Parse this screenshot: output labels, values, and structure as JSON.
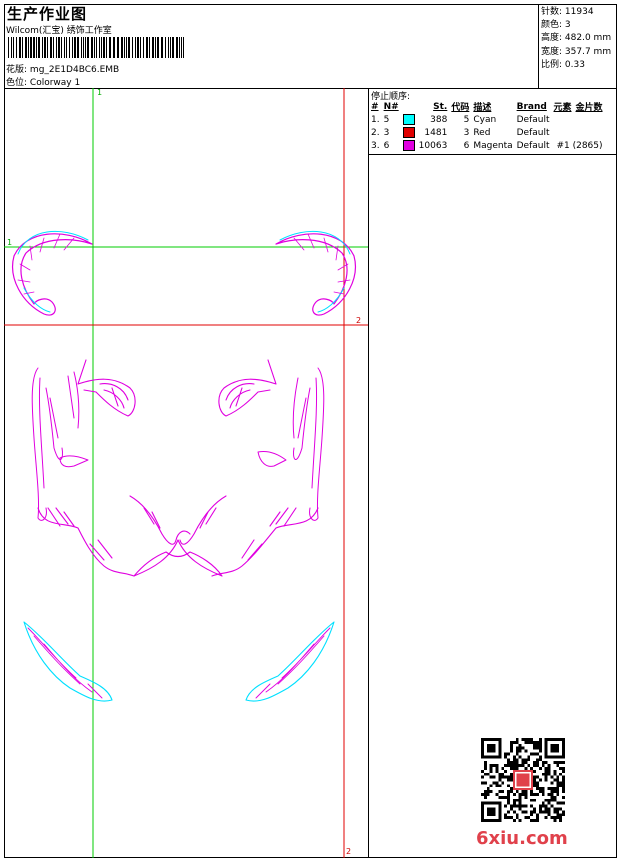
{
  "header": {
    "title": "生产作业图",
    "company": "Wilcom(汇宝) 绣饰工作室",
    "design_label": "花版:",
    "design_value": "mg_2E1D4BC6.EMB",
    "colorway_label": "色位:",
    "colorway_value": "Colorway 1"
  },
  "stats": [
    {
      "label": "针数:",
      "value": "11934"
    },
    {
      "label": "颜色:",
      "value": "3"
    },
    {
      "label": "高度:",
      "value": "482.0 mm"
    },
    {
      "label": "宽度:",
      "value": "357.7 mm"
    },
    {
      "label": "比例:",
      "value": "0.33"
    }
  ],
  "sequence": {
    "title": "停止顺序:",
    "headers": [
      "#",
      "N#",
      "",
      "St.",
      "代码",
      "描述",
      "Brand",
      "元素",
      "金片数"
    ],
    "rows": [
      {
        "idx": "1.",
        "needle": "5",
        "color": "#00ffff",
        "stitches": "388",
        "code": "5",
        "desc": "Cyan",
        "brand": "Default",
        "element": "",
        "sequin": ""
      },
      {
        "idx": "2.",
        "needle": "3",
        "color": "#e00000",
        "stitches": "1481",
        "code": "3",
        "desc": "Red",
        "brand": "Default",
        "element": "",
        "sequin": ""
      },
      {
        "idx": "3.",
        "needle": "6",
        "color": "#e000e0",
        "stitches": "10063",
        "code": "6",
        "desc": "Magenta",
        "brand": "Default",
        "element": "#1 (2865)",
        "sequin": ""
      }
    ]
  },
  "markers": {
    "m1_top": "1",
    "m1_left": "1",
    "m2_right": "2",
    "m2_bottom": "2"
  },
  "colors": {
    "guide_green": "#00cc00",
    "guide_red": "#e00000",
    "thread_magenta": "#e000e0",
    "thread_cyan": "#00e0ff"
  },
  "watermark": "6xiu.com"
}
